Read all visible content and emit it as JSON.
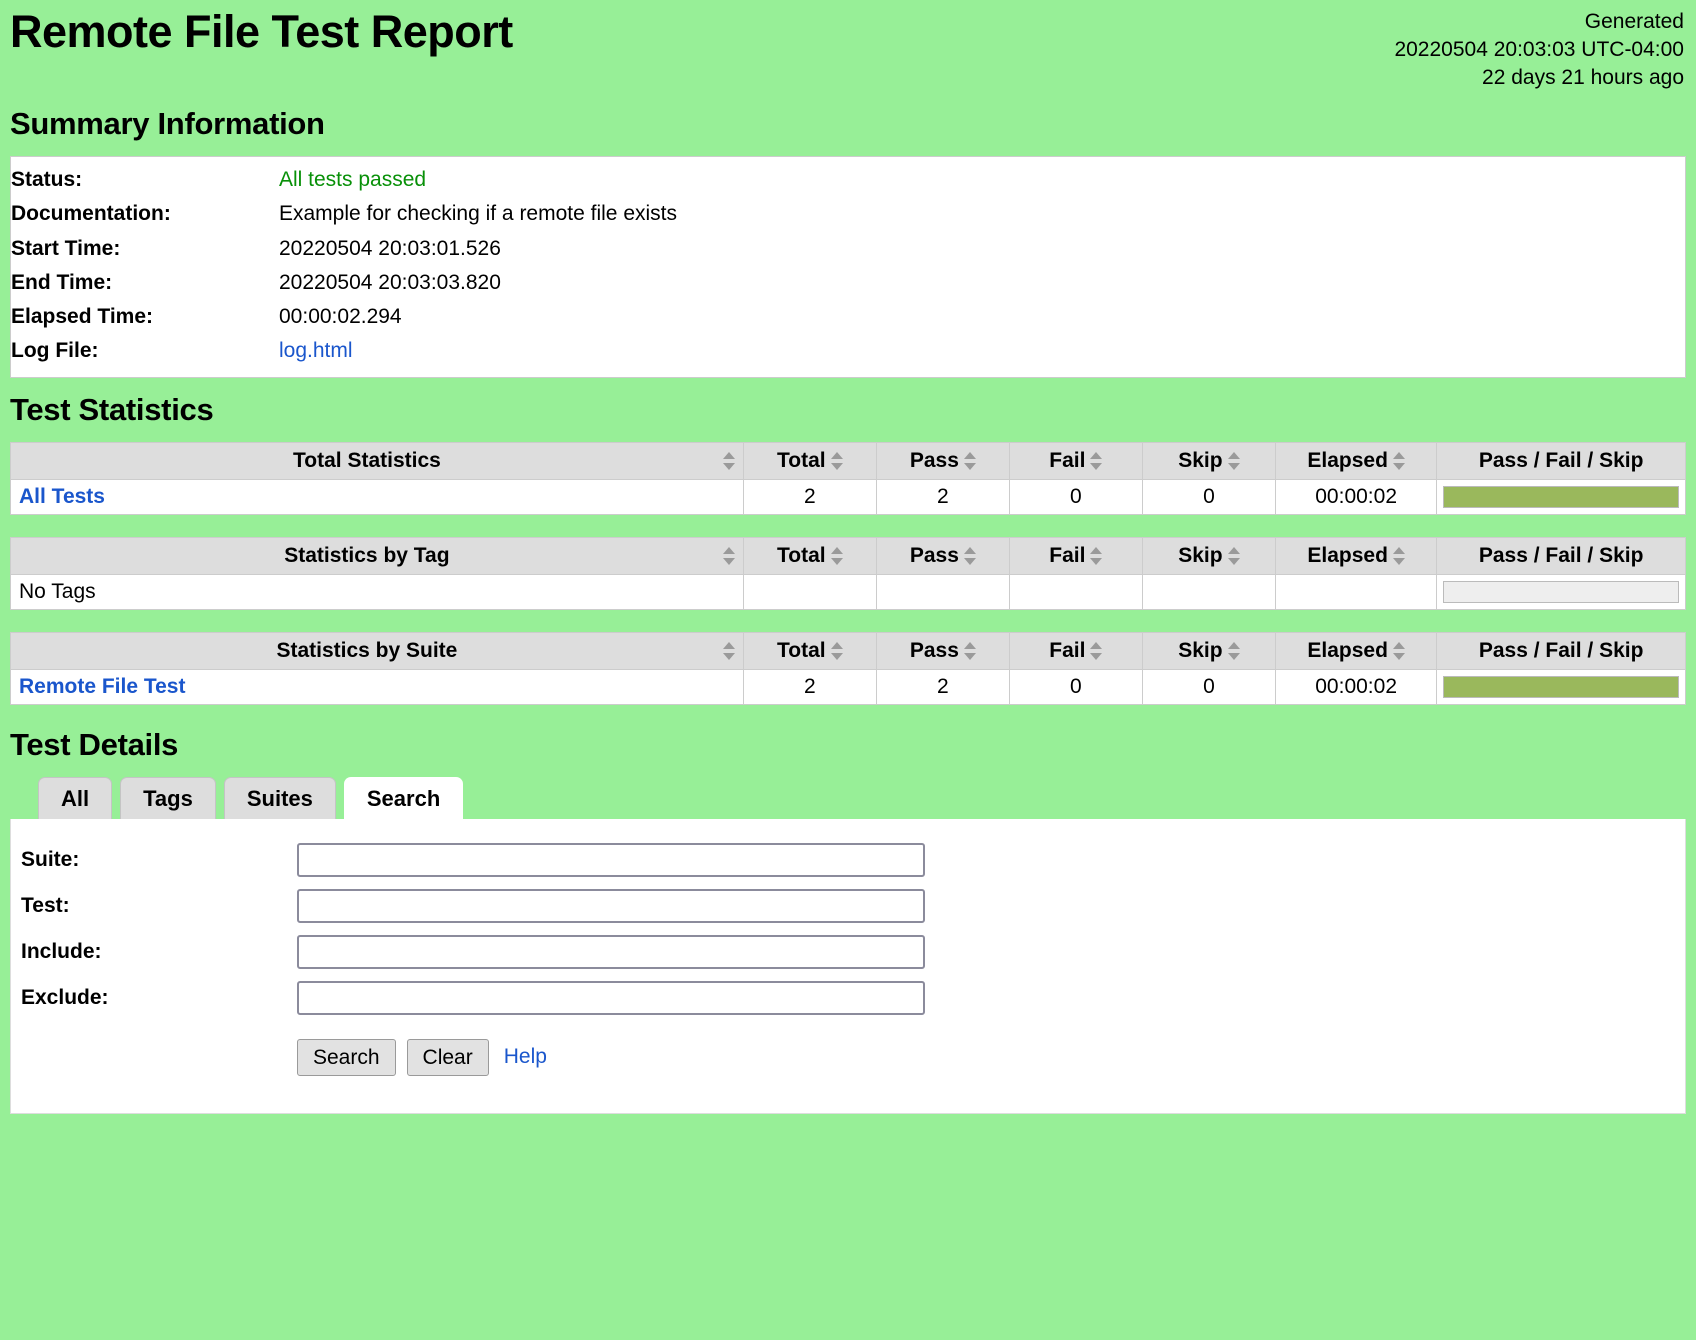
{
  "header": {
    "title": "Remote File Test Report",
    "generated_label": "Generated",
    "generated_time": "20220504 20:03:03 UTC-04:00",
    "generated_ago": "22 days 21 hours ago"
  },
  "summary": {
    "heading": "Summary Information",
    "rows": [
      {
        "label": "Status:",
        "value": "All tests passed",
        "kind": "status-pass"
      },
      {
        "label": "Documentation:",
        "value": "Example for checking if a remote file exists",
        "kind": "text"
      },
      {
        "label": "Start Time:",
        "value": "20220504 20:03:01.526",
        "kind": "text"
      },
      {
        "label": "End Time:",
        "value": "20220504 20:03:03.820",
        "kind": "text"
      },
      {
        "label": "Elapsed Time:",
        "value": "00:00:02.294",
        "kind": "text"
      },
      {
        "label": "Log File:",
        "value": "log.html",
        "kind": "link"
      }
    ]
  },
  "statistics": {
    "heading": "Test Statistics",
    "columns": [
      "Total",
      "Pass",
      "Fail",
      "Skip",
      "Elapsed",
      "Pass / Fail / Skip"
    ],
    "tables": [
      {
        "name_header": "Total Statistics",
        "rows": [
          {
            "name": "All Tests",
            "is_link": true,
            "total": "2",
            "pass": "2",
            "fail": "0",
            "skip": "0",
            "elapsed": "00:00:02",
            "pass_pct": 100,
            "fail_pct": 0,
            "skip_pct": 0,
            "has_bar": true
          }
        ]
      },
      {
        "name_header": "Statistics by Tag",
        "rows": [
          {
            "name": "No Tags",
            "is_link": false,
            "total": "",
            "pass": "",
            "fail": "",
            "skip": "",
            "elapsed": "",
            "pass_pct": 0,
            "fail_pct": 0,
            "skip_pct": 0,
            "has_bar": true
          }
        ]
      },
      {
        "name_header": "Statistics by Suite",
        "rows": [
          {
            "name": "Remote File Test",
            "is_link": true,
            "total": "2",
            "pass": "2",
            "fail": "0",
            "skip": "0",
            "elapsed": "00:00:02",
            "pass_pct": 100,
            "fail_pct": 0,
            "skip_pct": 0,
            "has_bar": true
          }
        ]
      }
    ]
  },
  "details": {
    "heading": "Test Details",
    "tabs": [
      {
        "label": "All",
        "active": false
      },
      {
        "label": "Tags",
        "active": false
      },
      {
        "label": "Suites",
        "active": false
      },
      {
        "label": "Search",
        "active": true
      }
    ],
    "search_form": {
      "fields": [
        {
          "label": "Suite:",
          "value": "",
          "placeholder": "",
          "name": "suite"
        },
        {
          "label": "Test:",
          "value": "",
          "placeholder": "",
          "name": "test"
        },
        {
          "label": "Include:",
          "value": "",
          "placeholder": "",
          "name": "include"
        },
        {
          "label": "Exclude:",
          "value": "",
          "placeholder": "",
          "name": "exclude"
        }
      ],
      "search_button": "Search",
      "clear_button": "Clear",
      "help_link": "Help"
    }
  },
  "colors": {
    "page_background": "#97ef97",
    "pass_bar": "#9ab85c",
    "empty_bar": "#eeeeee",
    "status_pass_text": "#089008",
    "link": "#1a56cc",
    "table_header": "#dddddd"
  }
}
